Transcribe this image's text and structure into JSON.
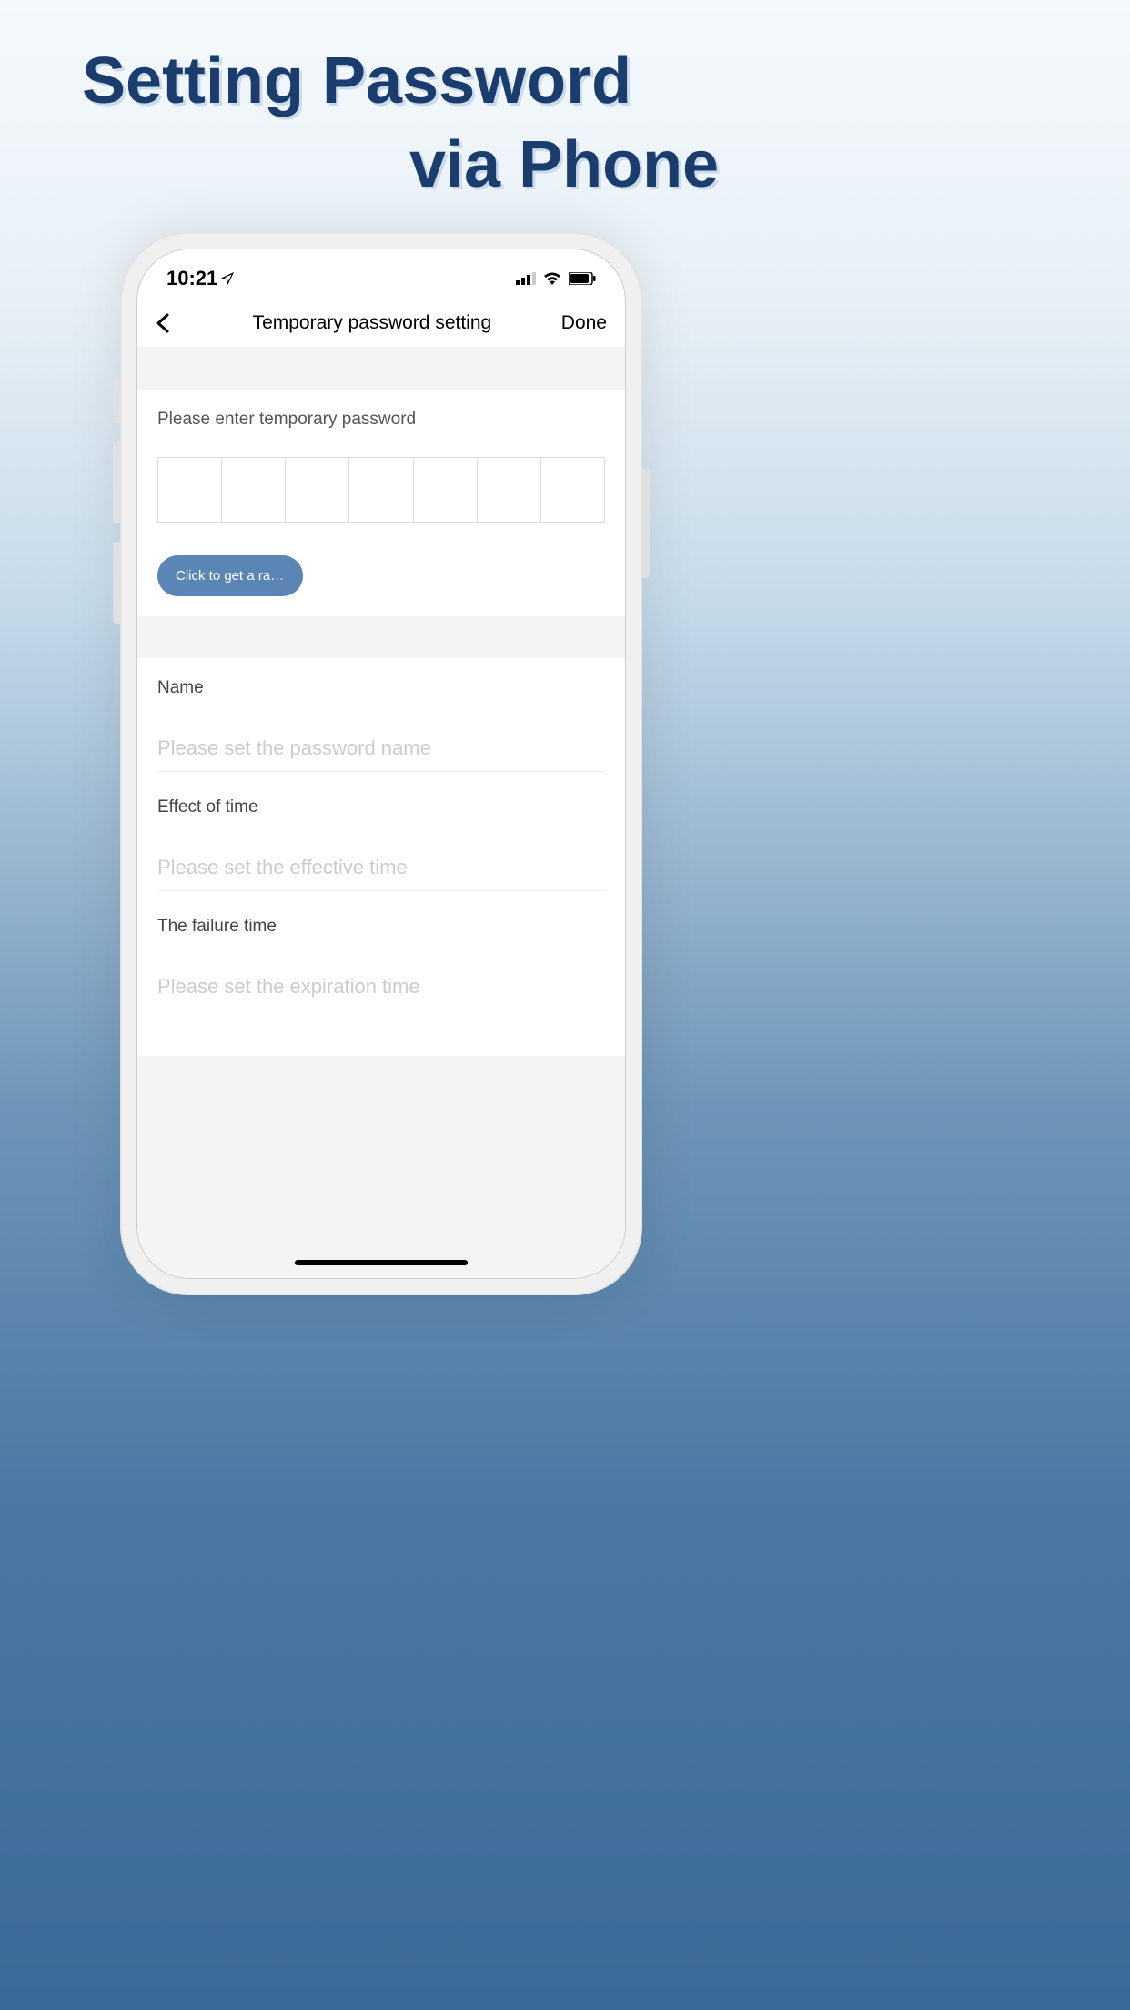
{
  "promo": {
    "line1": "Setting Password",
    "line2": "via Phone"
  },
  "statusBar": {
    "time": "10:21"
  },
  "navBar": {
    "title": "Temporary password setting",
    "doneLabel": "Done"
  },
  "passwordSection": {
    "label": "Please enter temporary password",
    "randomButton": "Click to get a rando...",
    "digitCount": 7
  },
  "fields": {
    "name": {
      "label": "Name",
      "placeholder": "Please set the password name",
      "value": ""
    },
    "effectTime": {
      "label": "Effect of time",
      "placeholder": "Please set the effective time",
      "value": ""
    },
    "failureTime": {
      "label": "The failure time",
      "placeholder": "Please set the expiration time",
      "value": ""
    }
  }
}
